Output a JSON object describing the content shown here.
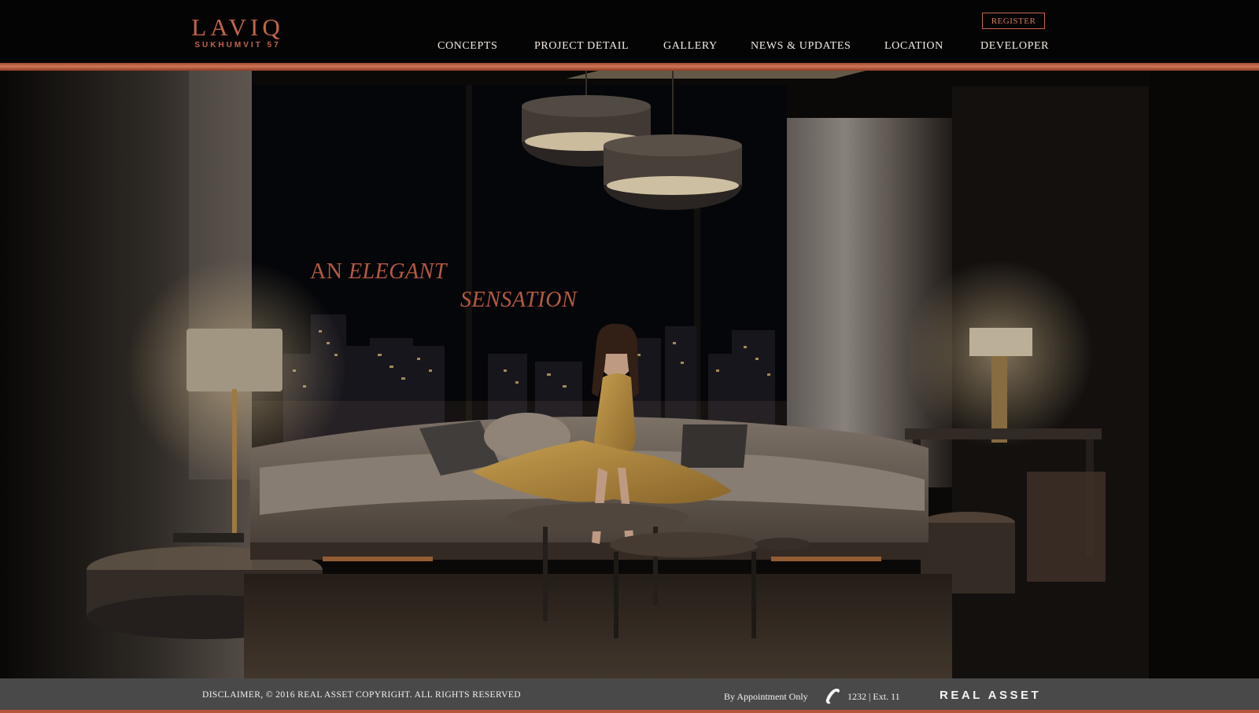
{
  "header": {
    "logo": {
      "name": "LAVIQ",
      "sub": "SUKHUMVIT 57"
    },
    "register_label": "REGISTER",
    "nav": [
      {
        "label": "CONCEPTS"
      },
      {
        "label": "PROJECT DETAIL"
      },
      {
        "label": "GALLERY"
      },
      {
        "label": "NEWS & UPDATES"
      },
      {
        "label": "LOCATION"
      },
      {
        "label": "DEVELOPER"
      }
    ]
  },
  "hero": {
    "tagline_line1_plain": "AN ",
    "tagline_line1_italic": "ELEGANT",
    "tagline_line2": "SENSATION",
    "image_icon": "luxury-living-room-photo"
  },
  "footer": {
    "disclaimer": "DISCLAIMER, © 2016 REAL ASSET COPYRIGHT. ALL RIGHTS RESERVED",
    "appointment": "By Appointment Only",
    "phone_icon": "phone-handset-icon",
    "phone": "1232 | Ext. 11",
    "brand": "REAL ASSET"
  },
  "colors": {
    "accent": "#c2654a",
    "header_bg": "#050404",
    "footer_bg": "#4a4949",
    "nav_text": "#f2ece4"
  }
}
